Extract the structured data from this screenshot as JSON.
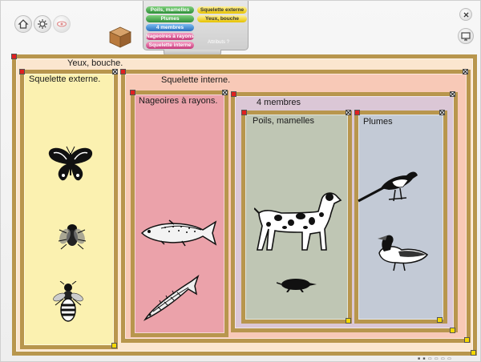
{
  "toolbar": {
    "home_icon": "house-icon",
    "tools_icon": "gear-icon",
    "eye_icon": "eye-icon",
    "crate_icon": "crate-icon",
    "close_icon": "close-icon",
    "export_icon": "monitor-icon"
  },
  "palette": {
    "items": [
      {
        "label": "Poils, mamelles",
        "color": "green"
      },
      {
        "label": "Squelette externe",
        "color": "yellow"
      },
      {
        "label": "Plumes",
        "color": "green"
      },
      {
        "label": "Yeux, bouche",
        "color": "yellow"
      },
      {
        "label": "4 membres",
        "color": "blue"
      },
      {
        "label": "Nageoires à rayons",
        "color": "pink"
      },
      {
        "label": "Squelette interne",
        "color": "pink"
      }
    ],
    "footer": "Attributs ?"
  },
  "sets": {
    "yeux_bouche": "Yeux, bouche.",
    "squelette_externe": "Squelette externe.",
    "squelette_interne": "Squelette interne.",
    "nageoires": "Nageoires à rayons.",
    "quatre_membres": "4 membres",
    "poils_mamelles": "Poils, mamelles",
    "plumes": "Plumes"
  },
  "animals": [
    "butterfly",
    "fly",
    "wasp",
    "trout",
    "pike",
    "dalmatian-dog",
    "mole",
    "magpie",
    "duck"
  ],
  "colors": {
    "outer_bg": "#fbe6cf",
    "externe_bg": "#fbf1b0",
    "interne_bg": "#f8c9b7",
    "nageoires_bg": "#eba2aa",
    "membres_bg": "#dbc7d6",
    "poils_bg": "#bfc6b4",
    "plumes_bg": "#c3cad6",
    "frame": "#b8964d"
  },
  "status": "■ ■ ▭ ▭ ▭ ▭"
}
